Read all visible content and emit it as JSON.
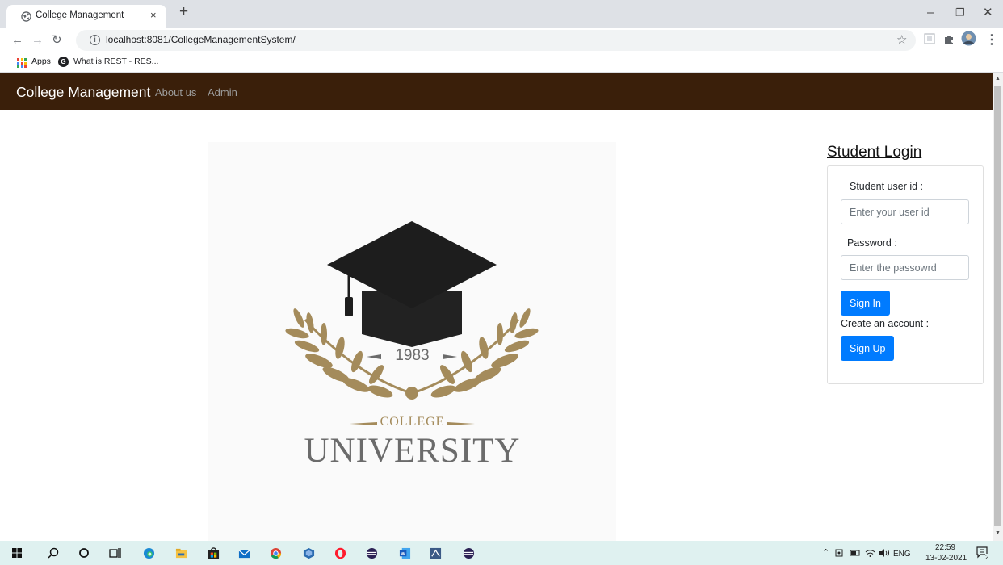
{
  "browser": {
    "tab_title": "College Management",
    "tab_close": "×",
    "new_tab": "+",
    "url": "localhost:8081/CollegeManagementSystem/",
    "bookmarks": {
      "apps_label": "Apps",
      "rest_label": "What is REST - RES..."
    },
    "icons": [
      "globe-icon",
      "back-arrow-icon",
      "forward-arrow-icon",
      "reload-icon",
      "info-icon",
      "star-icon",
      "extension-icon",
      "puzzle-icon",
      "profile-avatar-icon",
      "menu-dots-icon"
    ]
  },
  "navbar": {
    "brand": "College Management",
    "links": [
      "About us",
      "Admin"
    ],
    "bg_color": "#3a1f0a"
  },
  "logo": {
    "year": "1983",
    "college": "COLLEGE",
    "university": "UNIVERSITY",
    "gold_color": "#a48b5b"
  },
  "login": {
    "title": "Student Login",
    "userid_label": "Student user id :",
    "userid_placeholder": "Enter your user id",
    "password_label": "Password :",
    "password_placeholder": "Enter the passowrd",
    "signin_label": "Sign In",
    "create_label": "Create an account :",
    "signup_label": "Sign Up",
    "button_color": "#007bff"
  },
  "taskbar": {
    "lang": "ENG",
    "time": "22:59",
    "date": "13-02-2021",
    "notification_count": "2"
  }
}
